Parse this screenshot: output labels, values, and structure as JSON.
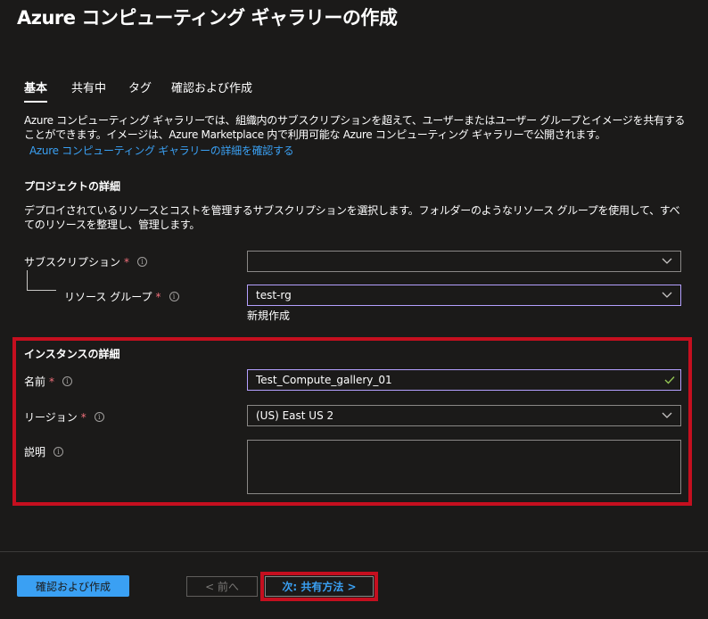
{
  "header": {
    "title": "Azure コンピューティング ギャラリーの作成",
    "more_label": "···"
  },
  "tabs": [
    {
      "label": "基本",
      "active": true
    },
    {
      "label": "共有中",
      "active": false
    },
    {
      "label": "タグ",
      "active": false
    },
    {
      "label": "確認および作成",
      "active": false
    }
  ],
  "intro": {
    "text": "Azure コンピューティング ギャラリーでは、組織内のサブスクリプションを超えて、ユーザーまたはユーザー グループとイメージを共有することができます。イメージは、Azure Marketplace 内で利用可能な Azure コンピューティング ギャラリーで公開されます。",
    "link": "Azure コンピューティング ギャラリーの詳細を確認する"
  },
  "project": {
    "heading": "プロジェクトの詳細",
    "desc": "デプロイされているリソースとコストを管理するサブスクリプションを選択します。フォルダーのようなリソース グループを使用して、すべてのリソースを整理し、管理します。",
    "subscription_label": "サブスクリプション",
    "subscription_value": "",
    "resource_group_label": "リソース グループ",
    "resource_group_value": "test-rg",
    "create_new_link": "新規作成"
  },
  "instance": {
    "heading": "インスタンスの詳細",
    "name_label": "名前",
    "name_value": "Test_Compute_gallery_01",
    "region_label": "リージョン",
    "region_value": "(US) East US 2",
    "description_label": "説明",
    "description_value": ""
  },
  "footer": {
    "review_create": "確認および作成",
    "prev": "< 前へ",
    "next": "次: 共有方法 >"
  },
  "required_marker": "*",
  "info_icon": "i",
  "colors": {
    "background": "#1b1a19",
    "accent": "#3aa0f3",
    "required": "#f1707b",
    "highlight_box": "#c50f1f",
    "focus_border": "#b4a0ff",
    "valid_check": "#92c353"
  }
}
